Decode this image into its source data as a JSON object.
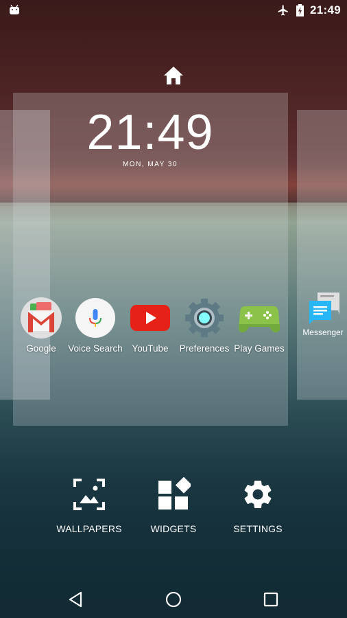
{
  "status_bar": {
    "notification_icon": "android-debug-icon",
    "airplane_icon": "airplane-mode-icon",
    "battery_icon": "battery-charging-icon",
    "time": "21:49"
  },
  "home_indicator_icon": "home-icon",
  "clock_widget": {
    "time": "21:49",
    "date": "MON, MAY 30"
  },
  "apps": [
    {
      "label": "Google",
      "icon": "gmail-folder-icon"
    },
    {
      "label": "Voice Search",
      "icon": "microphone-icon"
    },
    {
      "label": "YouTube",
      "icon": "youtube-icon"
    },
    {
      "label": "Preferences",
      "icon": "settings-gear-icon"
    },
    {
      "label": "Play Games",
      "icon": "gamepad-icon"
    }
  ],
  "adjacent_page_apps": [
    {
      "label": "Messenger",
      "icon": "messenger-icon"
    }
  ],
  "overview_actions": [
    {
      "label": "WALLPAPERS",
      "icon": "wallpaper-icon"
    },
    {
      "label": "WIDGETS",
      "icon": "widgets-icon"
    },
    {
      "label": "SETTINGS",
      "icon": "settings-icon"
    }
  ],
  "nav_bar": {
    "back": "back-icon",
    "home": "home-circle-icon",
    "recents": "recents-icon"
  },
  "colors": {
    "youtube_red": "#e62117",
    "play_games_green": "#8bc34a",
    "messenger_blue": "#29b6f6",
    "gmail_red": "#db4437"
  }
}
